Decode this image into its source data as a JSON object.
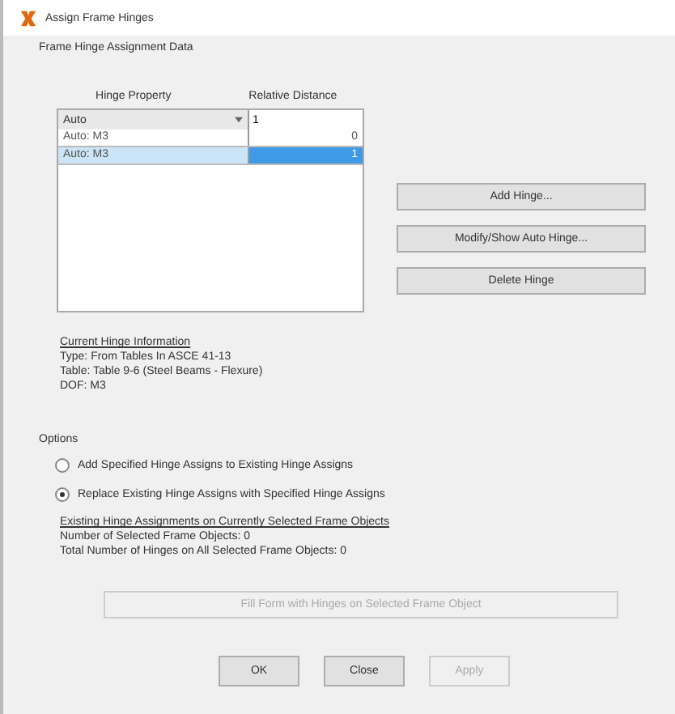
{
  "window": {
    "title": "Assign Frame Hinges"
  },
  "group_title": "Frame Hinge Assignment Data",
  "table": {
    "columns": [
      "Hinge Property",
      "Relative Distance"
    ],
    "entry": {
      "property": "Auto",
      "distance": "1"
    },
    "rows": [
      {
        "property": "Auto: M3",
        "distance": "0",
        "selected": false
      },
      {
        "property": "Auto: M3",
        "distance": "1",
        "selected": true
      }
    ]
  },
  "side_buttons": [
    {
      "label": "Add Hinge..."
    },
    {
      "label": "Modify/Show Auto Hinge..."
    },
    {
      "label": "Delete Hinge"
    }
  ],
  "current_hinge": {
    "heading": "Current Hinge Information",
    "lines": [
      "Type: From Tables In ASCE 41-13",
      "Table: Table 9-6 (Steel Beams - Flexure)",
      "DOF: M3"
    ]
  },
  "options": {
    "heading": "Options",
    "radios": [
      {
        "label": "Add Specified Hinge Assigns to Existing Hinge Assigns",
        "selected": false
      },
      {
        "label": "Replace Existing Hinge Assigns with Specified Hinge Assigns",
        "selected": true
      }
    ]
  },
  "existing": {
    "heading": "Existing Hinge Assignments on Currently Selected Frame Objects",
    "lines": [
      "Number of Selected Frame Objects: 0",
      "Total Number of Hinges on All Selected Frame Objects: 0"
    ]
  },
  "fill_button": {
    "label": "Fill Form with Hinges on Selected Frame Object",
    "disabled": true
  },
  "buttons": [
    {
      "label": "OK",
      "disabled": false
    },
    {
      "label": "Close",
      "disabled": false
    },
    {
      "label": "Apply",
      "disabled": true
    }
  ]
}
